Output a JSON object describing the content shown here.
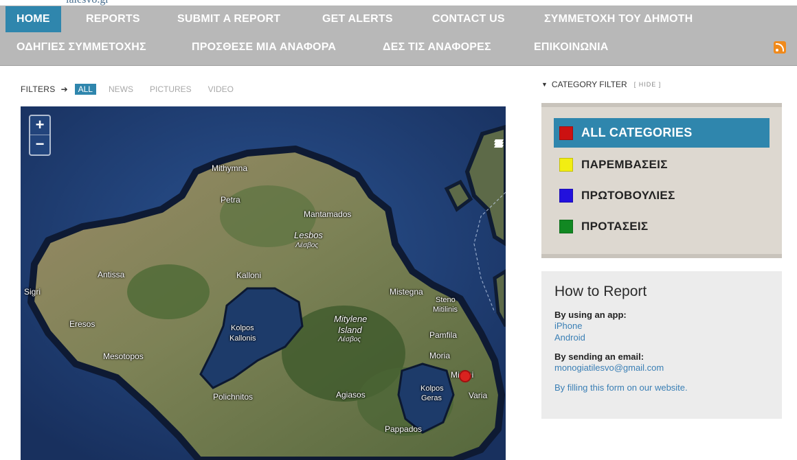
{
  "logo_text": "ialesvo.gr",
  "nav": {
    "row1": [
      "HOME",
      "REPORTS",
      "SUBMIT A REPORT",
      "GET ALERTS",
      "CONTACT US",
      "ΣΥΜΜΕΤΟΧΗ ΤΟΥ ΔΗΜΟΤΗ"
    ],
    "row2": [
      "ΟΔΗΓΙΕΣ ΣΥΜΜΕΤΟΧΗΣ",
      "ΠΡΟΣΘΕΣΕ ΜΙΑ ΑΝΑΦΟΡΑ",
      "ΔΕΣ ΤΙΣ ΑΝΑΦΟΡΕΣ",
      "ΕΠΙΚΟΙΝΩΝΙΑ"
    ],
    "active": "HOME"
  },
  "filters": {
    "label": "FILTERS",
    "arrow": "➔",
    "items": [
      "ALL",
      "NEWS",
      "PICTURES",
      "VIDEO"
    ]
  },
  "map": {
    "zoom_in": "+",
    "zoom_out": "−",
    "labels": {
      "mithymna": "Mithymna",
      "petra": "Petra",
      "mantamados": "Mantamados",
      "lesbos": "Lesbos",
      "lesbos_gr": "Λέσβος",
      "antissa": "Antissa",
      "kalloni": "Kalloni",
      "sigri": "Sigri",
      "mistegna": "Mistegna",
      "steno": "Steno",
      "mitilinis": "Mitilinis",
      "eresos": "Eresos",
      "kolpos_kallonis_1": "Kolpos",
      "kolpos_kallonis_2": "Kallonis",
      "mytilene_1": "Mitylene",
      "mytilene_2": "Island",
      "mytilene_gr": "Λέσβος",
      "pamfila": "Pamfila",
      "mesotopos": "Mesotopos",
      "moria": "Moria",
      "mitilini": "Mitilini",
      "kolpos_geras_1": "Kolpos",
      "kolpos_geras_2": "Geras",
      "varia": "Varia",
      "polichnitos": "Polichnitos",
      "agiasos": "Agiasos",
      "pappados": "Pappados"
    }
  },
  "category_filter": {
    "down_arrow": "▼",
    "title": "CATEGORY FILTER",
    "hide": "[ HIDE ]",
    "items": [
      {
        "label": "ALL CATEGORIES",
        "color": "#cc1111"
      },
      {
        "label": "ΠΑΡΕΜΒΑΣΕΙΣ",
        "color": "#f2ee12"
      },
      {
        "label": "ΠΡΩΤΟΒΟΥΛΙΕΣ",
        "color": "#2211dd"
      },
      {
        "label": "ΠΡΟΤΑΣΕΙΣ",
        "color": "#118822"
      }
    ]
  },
  "how_to": {
    "title": "How to Report",
    "app_label": "By using an app:",
    "iphone": "iPhone",
    "android": "Android",
    "email_label": "By sending an email:",
    "email": "monogiatilesvo@gmail.com",
    "form": "By filling this form on our website."
  },
  "colors": {
    "accent": "#2f86ad",
    "nav_bg": "#b8b8b8",
    "marker": "#d9221f"
  }
}
